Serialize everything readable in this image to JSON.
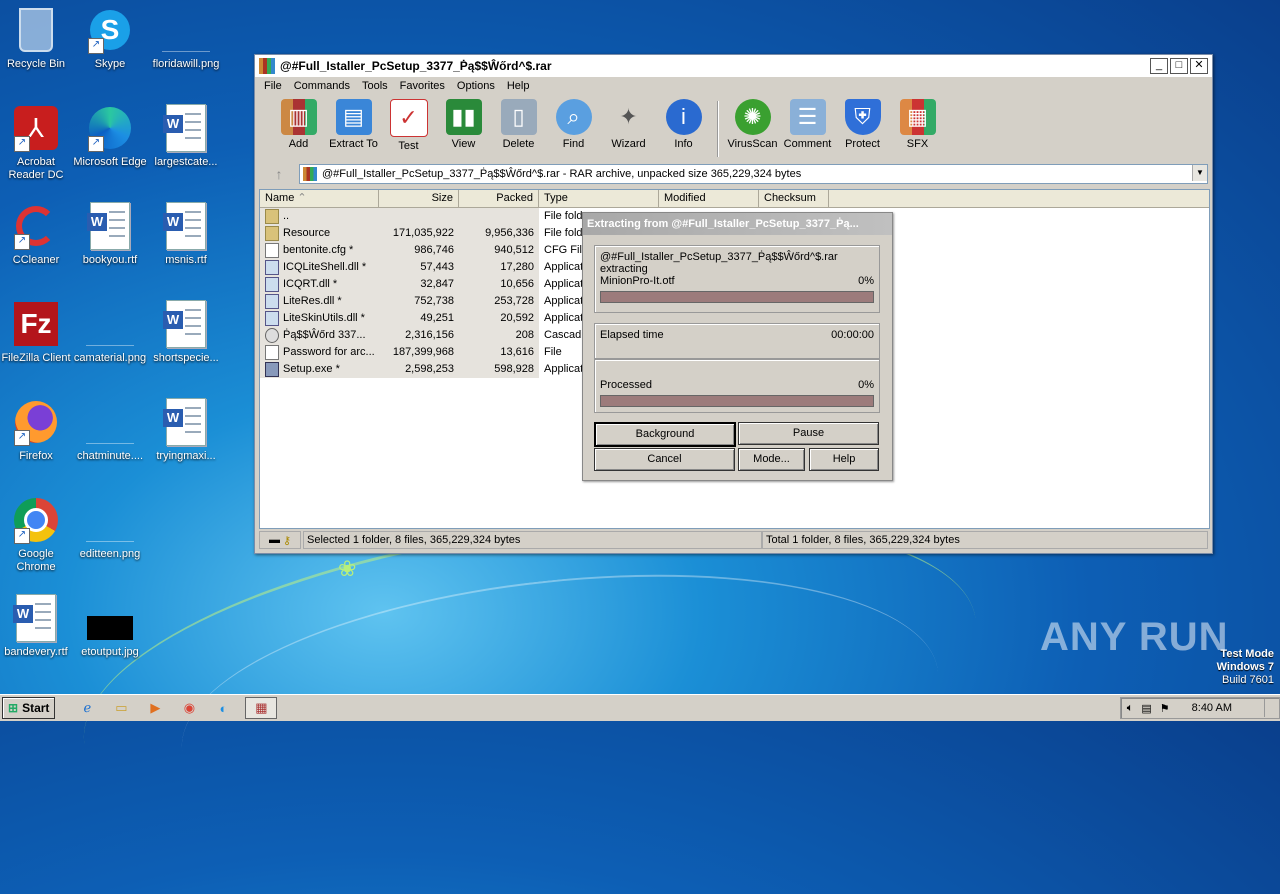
{
  "desktop": {
    "icons": [
      {
        "label": "Recycle Bin"
      },
      {
        "label": "Skype"
      },
      {
        "label": "floridawill.png"
      },
      {
        "label": "Acrobat Reader DC"
      },
      {
        "label": "Microsoft Edge"
      },
      {
        "label": "largestcate..."
      },
      {
        "label": "CCleaner"
      },
      {
        "label": "bookyou.rtf"
      },
      {
        "label": "msnis.rtf"
      },
      {
        "label": "FileZilla Client"
      },
      {
        "label": "camaterial.png"
      },
      {
        "label": "shortspecie..."
      },
      {
        "label": "Firefox"
      },
      {
        "label": "chatminute...."
      },
      {
        "label": "tryingmaxi..."
      },
      {
        "label": "Google Chrome"
      },
      {
        "label": "editteen.png"
      },
      {
        "label": "bandevery.rtf"
      },
      {
        "label": "etoutput.jpg"
      }
    ]
  },
  "window": {
    "title": "@#Full_Istaller_PcSetup_3377_Ṗą$$Ŵőrd^$.rar",
    "controls": {
      "minimize": "_",
      "maximize": "□",
      "close": "✕"
    },
    "menu": [
      "File",
      "Commands",
      "Tools",
      "Favorites",
      "Options",
      "Help"
    ],
    "toolbar": [
      {
        "label": "Add",
        "icon": "add-icon"
      },
      {
        "label": "Extract To",
        "icon": "extract-icon"
      },
      {
        "label": "Test",
        "icon": "test-icon"
      },
      {
        "label": "View",
        "icon": "view-icon"
      },
      {
        "label": "Delete",
        "icon": "delete-icon"
      },
      {
        "label": "Find",
        "icon": "find-icon"
      },
      {
        "label": "Wizard",
        "icon": "wizard-icon"
      },
      {
        "label": "Info",
        "icon": "info-icon"
      },
      {
        "label": "VirusScan",
        "icon": "virusscan-icon"
      },
      {
        "label": "Comment",
        "icon": "comment-icon"
      },
      {
        "label": "Protect",
        "icon": "protect-icon"
      },
      {
        "label": "SFX",
        "icon": "sfx-icon"
      }
    ],
    "address": "@#Full_Istaller_PcSetup_3377_Ṗą$$Ŵőrd^$.rar - RAR archive, unpacked size 365,229,324 bytes",
    "columns": [
      "Name",
      "Size",
      "Packed",
      "Type",
      "Modified",
      "Checksum"
    ],
    "files": [
      {
        "name": "..",
        "size": "",
        "packed": "",
        "type": "File fold",
        "kind": "folder"
      },
      {
        "name": "Resource",
        "size": "171,035,922",
        "packed": "9,956,336",
        "type": "File fold",
        "kind": "folder"
      },
      {
        "name": "bentonite.cfg *",
        "size": "986,746",
        "packed": "940,512",
        "type": "CFG File",
        "kind": "file"
      },
      {
        "name": "ICQLiteShell.dll *",
        "size": "57,443",
        "packed": "17,280",
        "type": "Applicat",
        "kind": "dll"
      },
      {
        "name": "ICQRT.dll *",
        "size": "32,847",
        "packed": "10,656",
        "type": "Applicat",
        "kind": "dll"
      },
      {
        "name": "LiteRes.dll *",
        "size": "752,738",
        "packed": "253,728",
        "type": "Applicat",
        "kind": "dll"
      },
      {
        "name": "LiteSkinUtils.dll *",
        "size": "49,251",
        "packed": "20,592",
        "type": "Applicat",
        "kind": "dll"
      },
      {
        "name": "Ṗą$$Ŵőrd   337...",
        "size": "2,316,156",
        "packed": "208",
        "type": "Cascadi",
        "kind": "gear"
      },
      {
        "name": "Password for arc...",
        "size": "187,399,968",
        "packed": "13,616",
        "type": "File",
        "kind": "file"
      },
      {
        "name": "Setup.exe *",
        "size": "2,598,253",
        "packed": "598,928",
        "type": "Applicat",
        "kind": "exe"
      }
    ],
    "status_left": "Selected 1 folder, 8 files, 365,229,324 bytes",
    "status_right": "Total 1 folder, 8 files, 365,229,324 bytes"
  },
  "dialog": {
    "title": "Extracting from @#Full_Istaller_PcSetup_3377_Ṗą...",
    "archive": "@#Full_Istaller_PcSetup_3377_Ṗą$$Ŵőrd^$.rar",
    "action": "extracting",
    "current_file": "MinionPro-It.otf",
    "file_percent": "0%",
    "file_progress": 0,
    "elapsed_label": "Elapsed time",
    "elapsed_value": "00:00:00",
    "processed_label": "Processed",
    "processed_percent": "0%",
    "processed_progress": 0,
    "buttons": {
      "background": "Background",
      "pause": "Pause",
      "cancel": "Cancel",
      "mode": "Mode...",
      "help": "Help"
    }
  },
  "watermark": {
    "text": "ANY RUN"
  },
  "os_info": {
    "line1": "Test Mode",
    "line2": "Windows 7",
    "line3": "Build 7601"
  },
  "taskbar": {
    "start": "Start",
    "clock": "8:40 AM"
  }
}
